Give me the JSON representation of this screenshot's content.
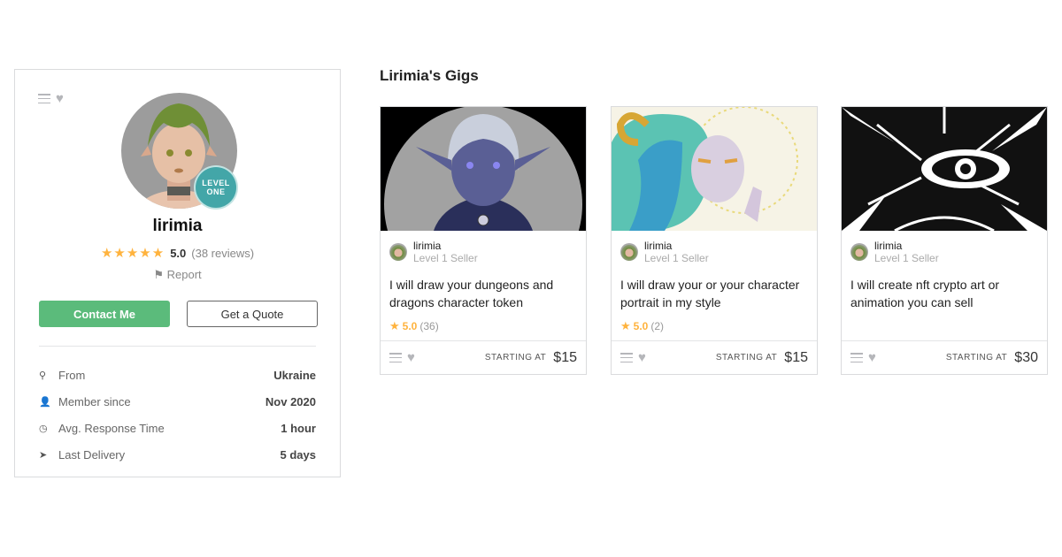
{
  "profile": {
    "username": "lirimia",
    "level_badge": [
      "LEVEL",
      "ONE"
    ],
    "stars": "★★★★★",
    "rating": "5.0",
    "reviews": "(38 reviews)",
    "report_label": "Report",
    "contact_label": "Contact Me",
    "quote_label": "Get a Quote",
    "stats": [
      {
        "icon": "location-pin-icon",
        "label": "From",
        "value": "Ukraine"
      },
      {
        "icon": "user-icon",
        "label": "Member since",
        "value": "Nov 2020"
      },
      {
        "icon": "clock-icon",
        "label": "Avg. Response Time",
        "value": "1 hour"
      },
      {
        "icon": "paper-plane-icon",
        "label": "Last Delivery",
        "value": "5 days"
      }
    ]
  },
  "gigs": {
    "title": "Lirimia's Gigs",
    "items": [
      {
        "seller": "lirimia",
        "level": "Level 1 Seller",
        "title": "I will draw your dungeons and dragons character token",
        "rating": "5.0",
        "count": "(36)",
        "starting_label": "STARTING AT",
        "price": "$15"
      },
      {
        "seller": "lirimia",
        "level": "Level 1 Seller",
        "title": "I will draw your or your character portrait in my style",
        "rating": "5.0",
        "count": "(2)",
        "starting_label": "STARTING AT",
        "price": "$15"
      },
      {
        "seller": "lirimia",
        "level": "Level 1 Seller",
        "title": "I will create nft crypto art or animation you can sell",
        "rating": null,
        "count": null,
        "starting_label": "STARTING AT",
        "price": "$30"
      }
    ]
  },
  "colors": {
    "accent_green": "#5bbb7b",
    "level_teal": "#43a6a8",
    "star": "#ffb33e"
  }
}
